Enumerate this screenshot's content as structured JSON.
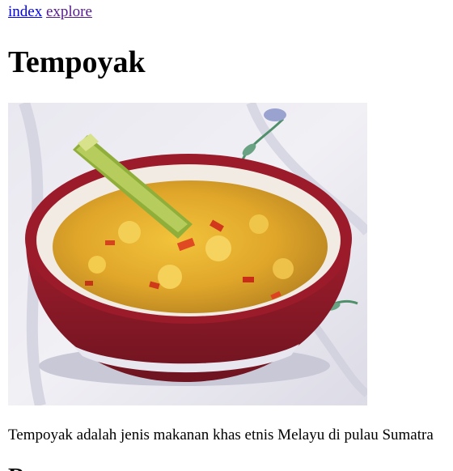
{
  "nav": {
    "index_label": "index",
    "explore_label": "explore"
  },
  "article": {
    "title": "Tempoyak",
    "intro": "Tempoyak adalah jenis makanan khas etnis Melayu di pulau Sumatra",
    "next_heading": "Resep"
  },
  "colors": {
    "link_unvisited": "#0000ee",
    "link_visited": "#551a8b"
  }
}
